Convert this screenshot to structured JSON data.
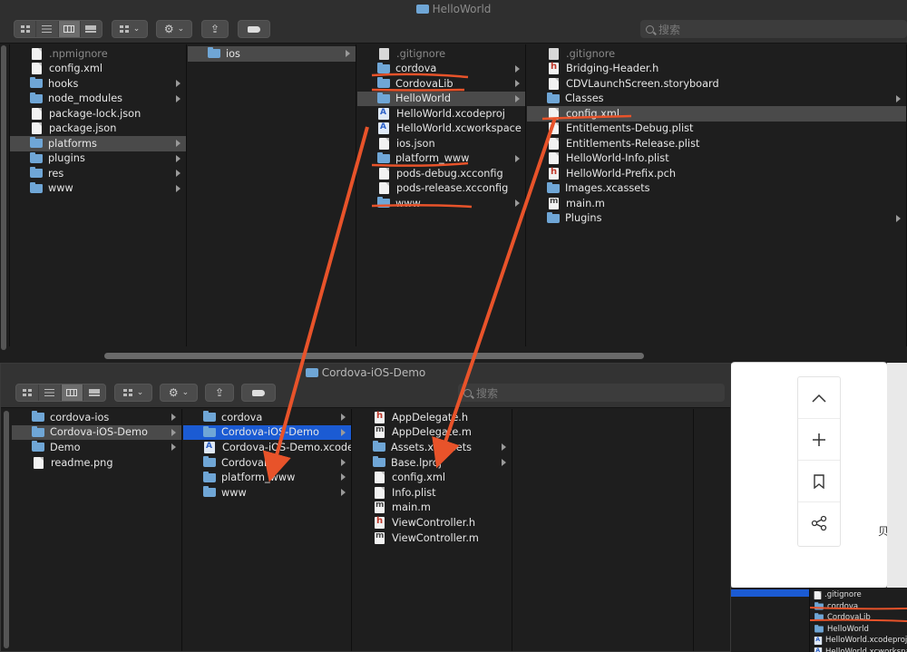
{
  "top_window": {
    "title": "HelloWorld",
    "search_placeholder": "搜索",
    "columns": [
      [
        {
          "label": ".npmignore",
          "icon": "file-icon",
          "dim": true
        },
        {
          "label": "config.xml",
          "icon": "file-icon"
        },
        {
          "label": "hooks",
          "icon": "folder-icon",
          "arrow": true
        },
        {
          "label": "node_modules",
          "icon": "folder-icon",
          "arrow": true
        },
        {
          "label": "package-lock.json",
          "icon": "file-icon"
        },
        {
          "label": "package.json",
          "icon": "file-icon"
        },
        {
          "label": "platforms",
          "icon": "folder-icon",
          "arrow": true,
          "selected": true
        },
        {
          "label": "plugins",
          "icon": "folder-icon",
          "arrow": true
        },
        {
          "label": "res",
          "icon": "folder-icon",
          "arrow": true
        },
        {
          "label": "www",
          "icon": "folder-icon",
          "arrow": true
        }
      ],
      [
        {
          "label": "ios",
          "icon": "folder-icon",
          "arrow": true,
          "selected": true
        }
      ],
      [
        {
          "label": ".gitignore",
          "icon": "gear-file-icon",
          "dim": true
        },
        {
          "label": "cordova",
          "icon": "folder-icon",
          "arrow": true
        },
        {
          "label": "CordovaLib",
          "icon": "folder-icon",
          "arrow": true
        },
        {
          "label": "HelloWorld",
          "icon": "folder-icon",
          "arrow": true,
          "selected": true
        },
        {
          "label": "HelloWorld.xcodeproj",
          "icon": "xcodeproj-icon"
        },
        {
          "label": "HelloWorld.xcworkspace",
          "icon": "xcodeproj-icon"
        },
        {
          "label": "ios.json",
          "icon": "file-icon"
        },
        {
          "label": "platform_www",
          "icon": "folder-icon",
          "arrow": true
        },
        {
          "label": "pods-debug.xcconfig",
          "icon": "file-icon"
        },
        {
          "label": "pods-release.xcconfig",
          "icon": "file-icon"
        },
        {
          "label": "www",
          "icon": "folder-icon",
          "arrow": true
        }
      ],
      [
        {
          "label": ".gitignore",
          "icon": "gear-file-icon",
          "dim": true
        },
        {
          "label": "Bridging-Header.h",
          "icon": "header-file-icon"
        },
        {
          "label": "CDVLaunchScreen.storyboard",
          "icon": "file-icon"
        },
        {
          "label": "Classes",
          "icon": "folder-icon",
          "arrow": true
        },
        {
          "label": "config.xml",
          "icon": "file-icon",
          "selected": true
        },
        {
          "label": "Entitlements-Debug.plist",
          "icon": "file-icon"
        },
        {
          "label": "Entitlements-Release.plist",
          "icon": "file-icon"
        },
        {
          "label": "HelloWorld-Info.plist",
          "icon": "file-icon"
        },
        {
          "label": "HelloWorld-Prefix.pch",
          "icon": "header-file-icon"
        },
        {
          "label": "Images.xcassets",
          "icon": "folder-icon"
        },
        {
          "label": "main.m",
          "icon": "m-file-icon"
        },
        {
          "label": "Plugins",
          "icon": "folder-icon",
          "arrow": true
        }
      ]
    ]
  },
  "bottom_window": {
    "title": "Cordova-iOS-Demo",
    "search_placeholder": "搜索",
    "columns": [
      [
        {
          "label": "cordova-ios",
          "icon": "folder-icon",
          "arrow": true
        },
        {
          "label": "Cordova-iOS-Demo",
          "icon": "folder-icon",
          "arrow": true,
          "selected": true
        },
        {
          "label": "Demo",
          "icon": "folder-icon",
          "arrow": true
        },
        {
          "label": "readme.png",
          "icon": "file-icon"
        }
      ],
      [
        {
          "label": "cordova",
          "icon": "folder-icon",
          "arrow": true
        },
        {
          "label": "Cordova-iOS-Demo",
          "icon": "folder-icon",
          "arrow": true,
          "active": true
        },
        {
          "label": "Cordova-iOS-Demo.xcodeproj",
          "icon": "xcodeproj-icon"
        },
        {
          "label": "CordovaLib",
          "icon": "folder-icon",
          "arrow": true
        },
        {
          "label": "platform_www",
          "icon": "folder-icon",
          "arrow": true
        },
        {
          "label": "www",
          "icon": "folder-icon",
          "arrow": true
        }
      ],
      [
        {
          "label": "AppDelegate.h",
          "icon": "header-file-icon"
        },
        {
          "label": "AppDelegate.m",
          "icon": "m-file-icon"
        },
        {
          "label": "Assets.xcassets",
          "icon": "folder-icon",
          "arrow": true
        },
        {
          "label": "Base.lproj",
          "icon": "folder-icon",
          "arrow": true
        },
        {
          "label": "config.xml",
          "icon": "file-icon"
        },
        {
          "label": "Info.plist",
          "icon": "file-icon"
        },
        {
          "label": "main.m",
          "icon": "m-file-icon"
        },
        {
          "label": "ViewController.h",
          "icon": "header-file-icon"
        },
        {
          "label": "ViewController.m",
          "icon": "m-file-icon"
        }
      ]
    ]
  },
  "side_toolbar": {
    "buttons": [
      {
        "name": "scroll-top-button",
        "glyph": "^"
      },
      {
        "name": "add-button",
        "glyph": "+"
      },
      {
        "name": "bookmark-button",
        "glyph": "bookmark"
      },
      {
        "name": "share-button",
        "glyph": "share"
      }
    ],
    "partial_text": "贝到"
  },
  "mini_list": [
    {
      "label": ".gitignore",
      "icon": "file-icon"
    },
    {
      "label": "cordova",
      "icon": "folder-icon"
    },
    {
      "label": "CordovaLib",
      "icon": "folder-icon"
    },
    {
      "label": "HelloWorld",
      "icon": "folder-icon"
    },
    {
      "label": "HelloWorld.xcodeproj",
      "icon": "xcodeproj-icon"
    },
    {
      "label": "HelloWorld.xcworkspace",
      "icon": "xcodeproj-icon"
    }
  ],
  "annotation_color": "#e8532a"
}
